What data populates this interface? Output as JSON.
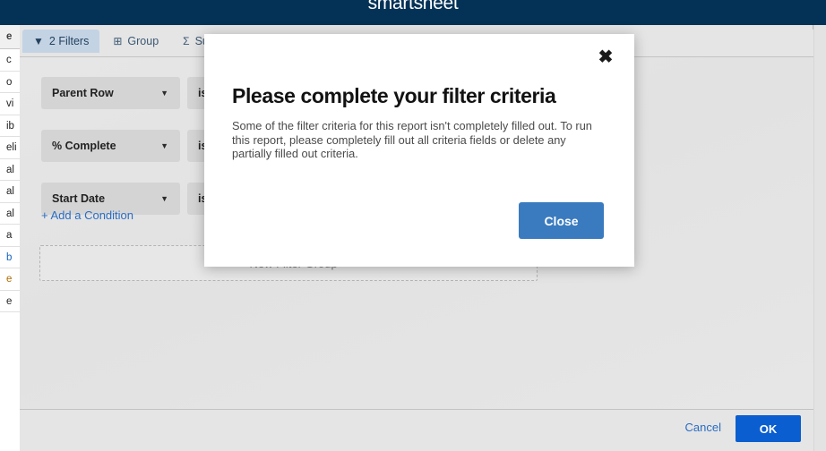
{
  "app_bar": {
    "logo_text": "smartsheet",
    "bg_color": "#043257"
  },
  "grid_strip": {
    "header_fragment": "e",
    "row_fragments": [
      {
        "text": "c",
        "style": "normal"
      },
      {
        "text": "o",
        "style": "normal"
      },
      {
        "text": "vi",
        "style": "normal"
      },
      {
        "text": "ib",
        "style": "normal"
      },
      {
        "text": "eli",
        "style": "normal"
      },
      {
        "text": "al",
        "style": "normal"
      },
      {
        "text": "al",
        "style": "normal"
      },
      {
        "text": "al",
        "style": "normal"
      },
      {
        "text": "a",
        "style": "normal"
      },
      {
        "text": "b",
        "style": "link"
      },
      {
        "text": "e",
        "style": "warn"
      },
      {
        "text": "e",
        "style": "normal"
      }
    ]
  },
  "filter_panel": {
    "tabs": [
      {
        "id": "filters",
        "label": "2 Filters",
        "icon": "filter-funnel-icon",
        "glyph": "▼",
        "active": true
      },
      {
        "id": "group",
        "label": "Group",
        "icon": "group-icon",
        "glyph": "⊞",
        "active": false
      },
      {
        "id": "summarize",
        "label": "Su",
        "icon": "sigma-icon",
        "glyph": "Σ",
        "active": false
      }
    ],
    "criteria": [
      {
        "field": "Parent Row",
        "operator": "is",
        "caret": "▼"
      },
      {
        "field": "% Complete",
        "operator": "is",
        "caret": "▼"
      },
      {
        "field": "Start Date",
        "operator": "is",
        "caret": "▼"
      }
    ],
    "add_condition_label": "+ Add a Condition",
    "new_filter_group_label": "+ New Filter Group",
    "footer": {
      "cancel_label": "Cancel",
      "ok_label": "OK",
      "ok_color": "#0b5ed0"
    }
  },
  "alert_dialog": {
    "title": "Please complete your filter criteria",
    "body": "Some of the filter criteria for this report isn't completely filled out. To run this report, please completely fill out all criteria fields or delete any partially filled out criteria.",
    "close_icon": "✖",
    "close_button_label": "Close",
    "close_button_color": "#3a7bbf"
  }
}
